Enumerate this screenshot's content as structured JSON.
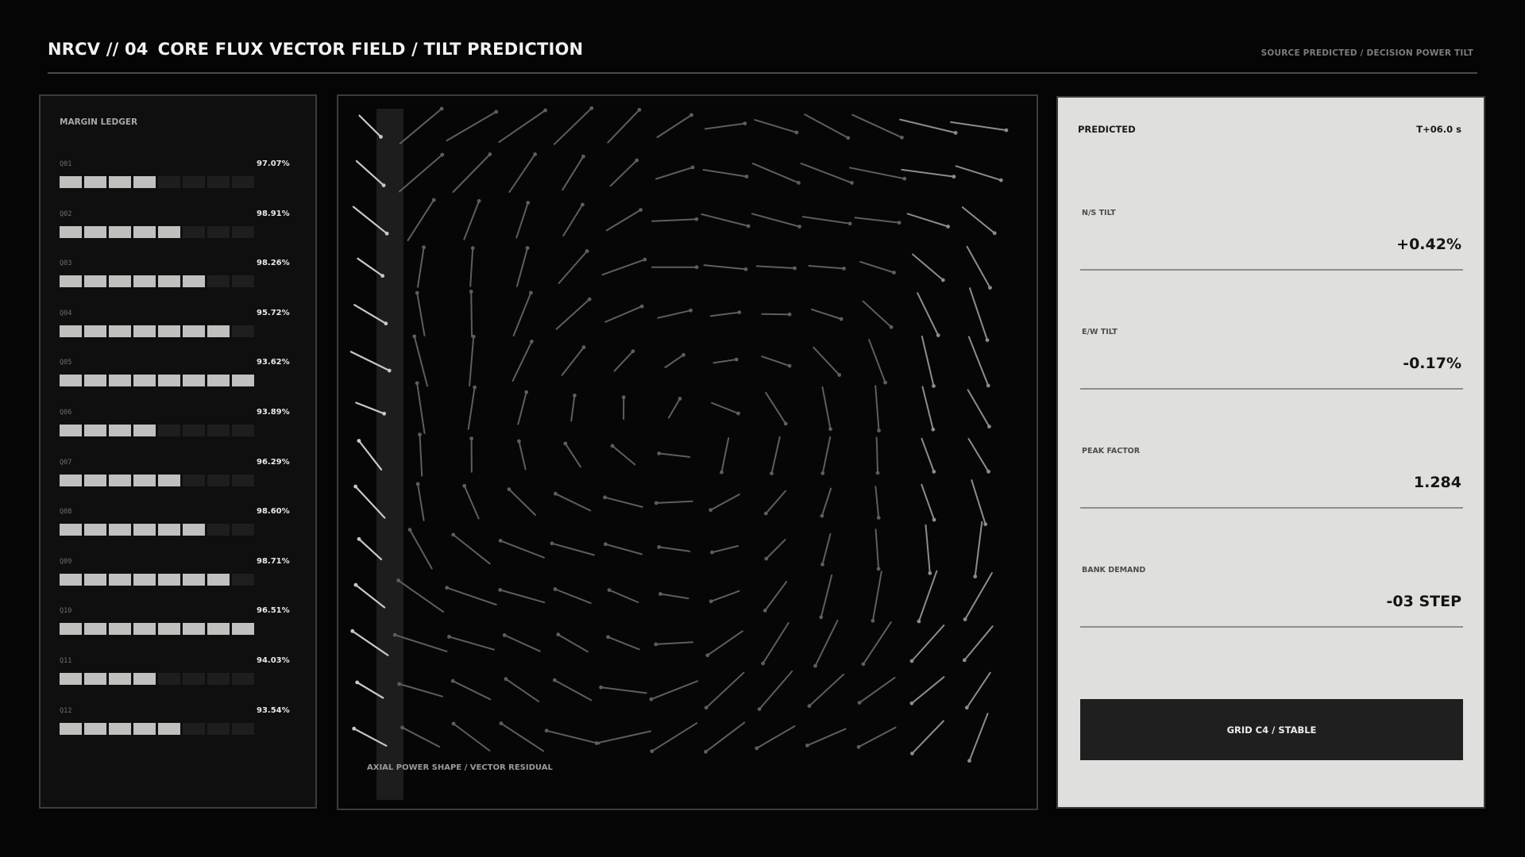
{
  "header": {
    "code": "NRCV // 04",
    "title": "CORE FLUX VECTOR FIELD / TILT PREDICTION",
    "source": "SOURCE PREDICTED / DECISION POWER TILT"
  },
  "ledger": {
    "title": "MARGIN LEDGER",
    "rows": [
      {
        "id": "Q01",
        "pct": "97.07%",
        "filled": 4
      },
      {
        "id": "Q02",
        "pct": "98.91%",
        "filled": 5
      },
      {
        "id": "Q03",
        "pct": "98.26%",
        "filled": 6
      },
      {
        "id": "Q04",
        "pct": "95.72%",
        "filled": 7
      },
      {
        "id": "Q05",
        "pct": "93.62%",
        "filled": 8
      },
      {
        "id": "Q06",
        "pct": "93.89%",
        "filled": 4
      },
      {
        "id": "Q07",
        "pct": "96.29%",
        "filled": 5
      },
      {
        "id": "Q08",
        "pct": "98.60%",
        "filled": 6
      },
      {
        "id": "Q09",
        "pct": "98.71%",
        "filled": 7
      },
      {
        "id": "Q10",
        "pct": "96.51%",
        "filled": 8
      },
      {
        "id": "Q11",
        "pct": "94.03%",
        "filled": 4
      },
      {
        "id": "Q12",
        "pct": "93.54%",
        "filled": 5
      }
    ],
    "segments_total": 8
  },
  "field": {
    "caption": "AXIAL POWER SHAPE / VECTOR RESIDUAL"
  },
  "prediction": {
    "title": "PREDICTED",
    "time": "T+06.0 s",
    "metrics": [
      {
        "label": "N/S TILT",
        "value": "+0.42%"
      },
      {
        "label": "E/W TILT",
        "value": "-0.17%"
      },
      {
        "label": "PEAK FACTOR",
        "value": "1.284"
      },
      {
        "label": "BANK DEMAND",
        "value": "-03 STEP"
      }
    ],
    "status_button": "GRID C4 / STABLE"
  },
  "colors": {
    "background": "#050505",
    "panel_light": "#dfe0dd",
    "segment_on": "#c0c1bf",
    "segment_off": "#1d1e1d",
    "vector_stroke": "#6a6a6a"
  }
}
